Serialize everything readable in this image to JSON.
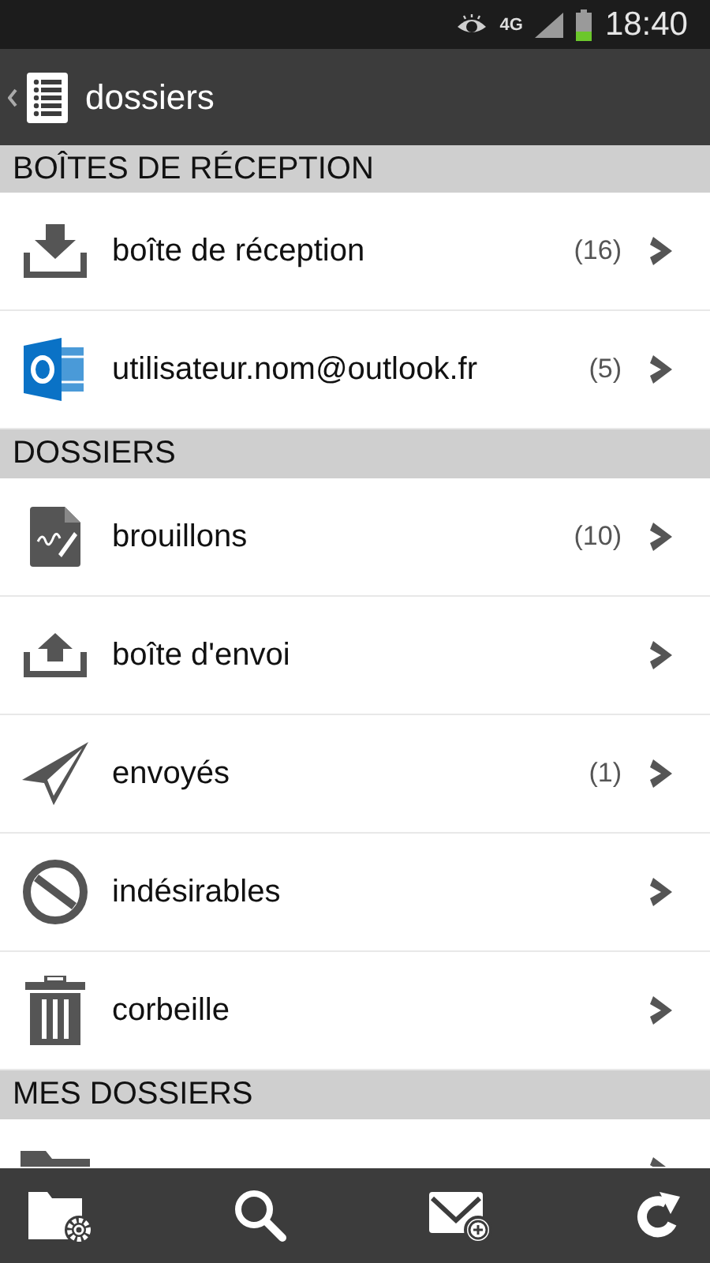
{
  "status_bar": {
    "network": "4G",
    "time": "18:40"
  },
  "action_bar": {
    "title": "dossiers"
  },
  "sections": [
    {
      "title": "BOÎTES DE RÉCEPTION",
      "items": [
        {
          "label": "boîte de réception",
          "count": "(16)"
        },
        {
          "label": "utilisateur.nom@outlook.fr",
          "count": "(5)"
        }
      ]
    },
    {
      "title": "DOSSIERS",
      "items": [
        {
          "label": "brouillons",
          "count": "(10)"
        },
        {
          "label": "boîte d'envoi"
        },
        {
          "label": "envoyés",
          "count": "(1)"
        },
        {
          "label": "indésirables"
        },
        {
          "label": "corbeille"
        }
      ]
    },
    {
      "title": "MES DOSSIERS",
      "items": [
        {
          "partial": true
        }
      ]
    }
  ]
}
